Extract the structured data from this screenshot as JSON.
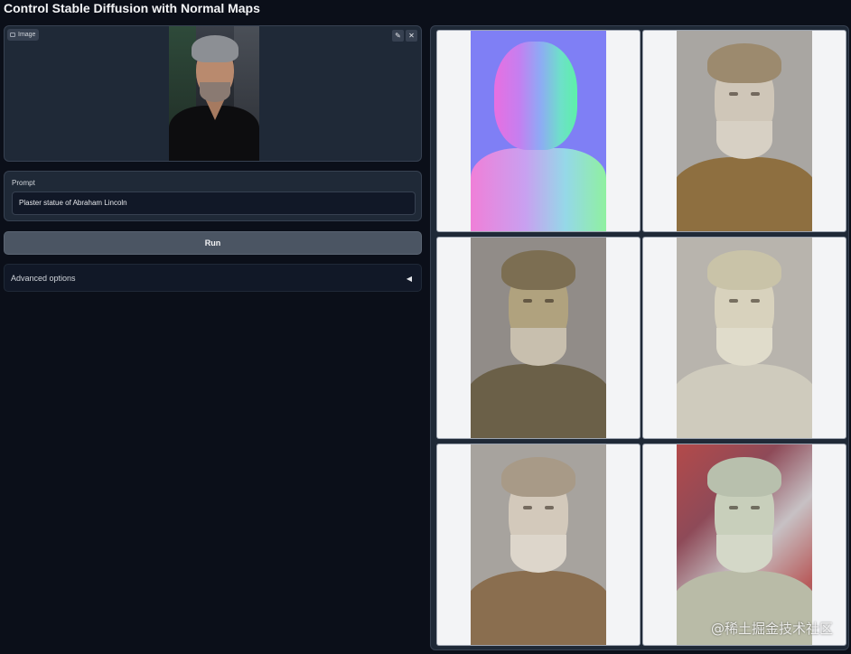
{
  "app": {
    "title": "Control Stable Diffusion with Normal Maps"
  },
  "image_input": {
    "label": "Image",
    "edit_icon": "✎",
    "close_icon": "✕"
  },
  "prompt": {
    "label": "Prompt",
    "value": "Plaster statue of Abraham Lincoln"
  },
  "run_button": {
    "label": "Run"
  },
  "advanced": {
    "label": "Advanced options",
    "caret": "◀"
  },
  "gallery": {
    "items": [
      {
        "kind": "normal-map"
      },
      {
        "kind": "statue"
      },
      {
        "kind": "statue"
      },
      {
        "kind": "statue"
      },
      {
        "kind": "statue"
      },
      {
        "kind": "statue"
      }
    ]
  },
  "watermark": "@稀土掘金技术社区",
  "colors": {
    "background": "#0b0f19",
    "panel": "#1f2937",
    "button": "#4b5563"
  }
}
